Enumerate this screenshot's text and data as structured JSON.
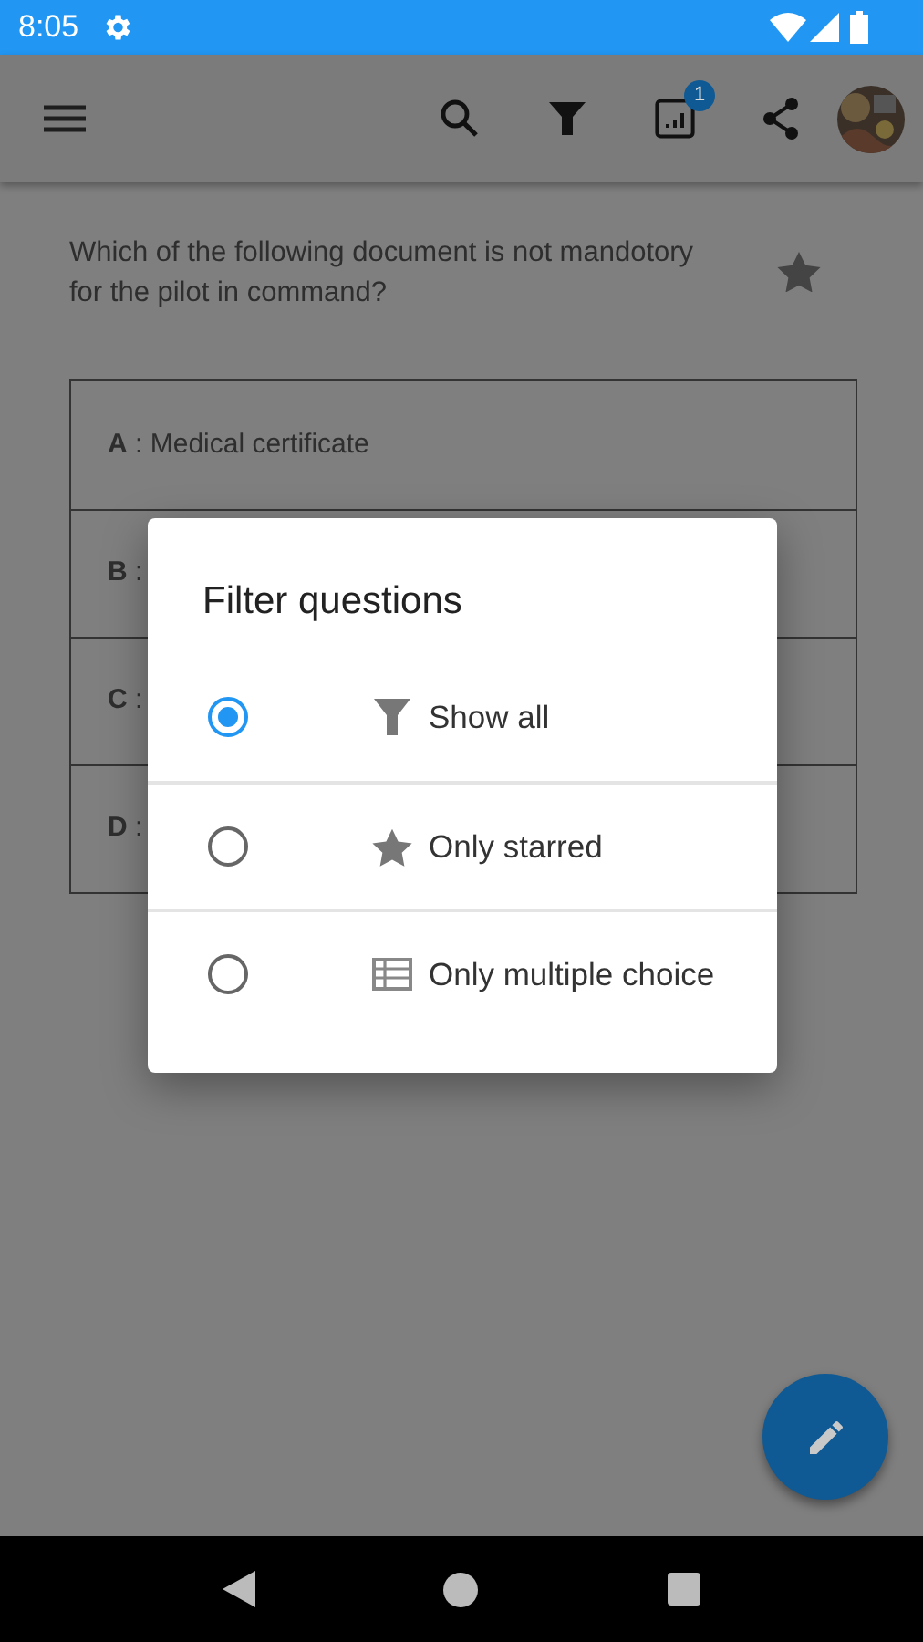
{
  "status_bar": {
    "time": "8:05"
  },
  "app_bar": {
    "badge": "1"
  },
  "question": {
    "text": "Which of the following document is not mandotory for the pilot in command?"
  },
  "answers": [
    {
      "letter": "A",
      "text": ": Medical certificate"
    },
    {
      "letter": "B",
      "text": ":"
    },
    {
      "letter": "C",
      "text": ":"
    },
    {
      "letter": "D",
      "text": ":"
    }
  ],
  "dialog": {
    "title": "Filter questions",
    "options": [
      {
        "kind": "filter",
        "label": "Show all",
        "selected": true
      },
      {
        "kind": "star",
        "label": "Only starred",
        "selected": false
      },
      {
        "kind": "list",
        "label": "Only multiple choice",
        "selected": false
      }
    ]
  }
}
